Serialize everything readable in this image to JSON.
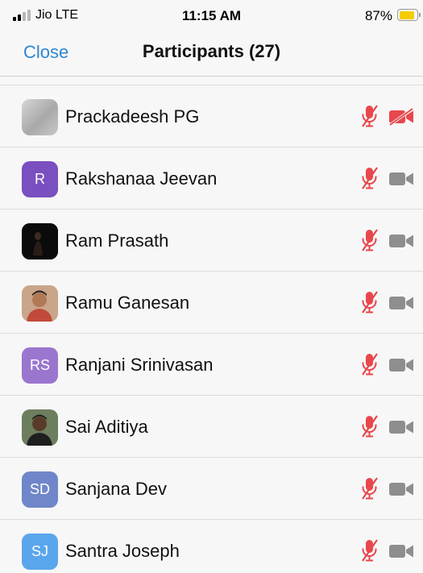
{
  "status_bar": {
    "carrier": "Jio  LTE",
    "time": "11:15 AM",
    "battery_percent": "87%",
    "battery_level": 0.87,
    "signal_bars_filled": 2,
    "signal_bars_total": 4
  },
  "nav": {
    "close_label": "Close",
    "title": "Participants (27)"
  },
  "colors": {
    "accent": "#2d87d2",
    "muted_red": "#e8474c",
    "camera_gray": "#8e8e8e",
    "battery_yellow": "#f5cc00"
  },
  "participants": [
    {
      "name": "Prackadeesh PG",
      "avatar_type": "blurred-photo",
      "avatar_initials": "",
      "avatar_color": "#bdbdbd",
      "mic_state": "muted",
      "video_state": "off"
    },
    {
      "name": "Rakshanaa Jeevan",
      "avatar_type": "initials",
      "avatar_initials": "R",
      "avatar_color": "#7a4fc0",
      "mic_state": "muted",
      "video_state": "no-video"
    },
    {
      "name": "Ram Prasath",
      "avatar_type": "photo-dark",
      "avatar_initials": "",
      "avatar_color": "#0d0d0d",
      "mic_state": "muted",
      "video_state": "no-video"
    },
    {
      "name": "Ramu Ganesan",
      "avatar_type": "photo",
      "avatar_initials": "",
      "avatar_color": "#8a6148",
      "mic_state": "muted",
      "video_state": "no-video"
    },
    {
      "name": "Ranjani Srinivasan",
      "avatar_type": "initials",
      "avatar_initials": "RS",
      "avatar_color": "#9a76cf",
      "mic_state": "muted",
      "video_state": "no-video"
    },
    {
      "name": "Sai Aditiya",
      "avatar_type": "photo",
      "avatar_initials": "",
      "avatar_color": "#4a3a30",
      "mic_state": "muted",
      "video_state": "no-video"
    },
    {
      "name": "Sanjana Dev",
      "avatar_type": "initials",
      "avatar_initials": "SD",
      "avatar_color": "#6f86c9",
      "mic_state": "muted",
      "video_state": "no-video"
    },
    {
      "name": "Santra Joseph",
      "avatar_type": "initials",
      "avatar_initials": "SJ",
      "avatar_color": "#5aa6ec",
      "mic_state": "muted",
      "video_state": "no-video"
    }
  ]
}
